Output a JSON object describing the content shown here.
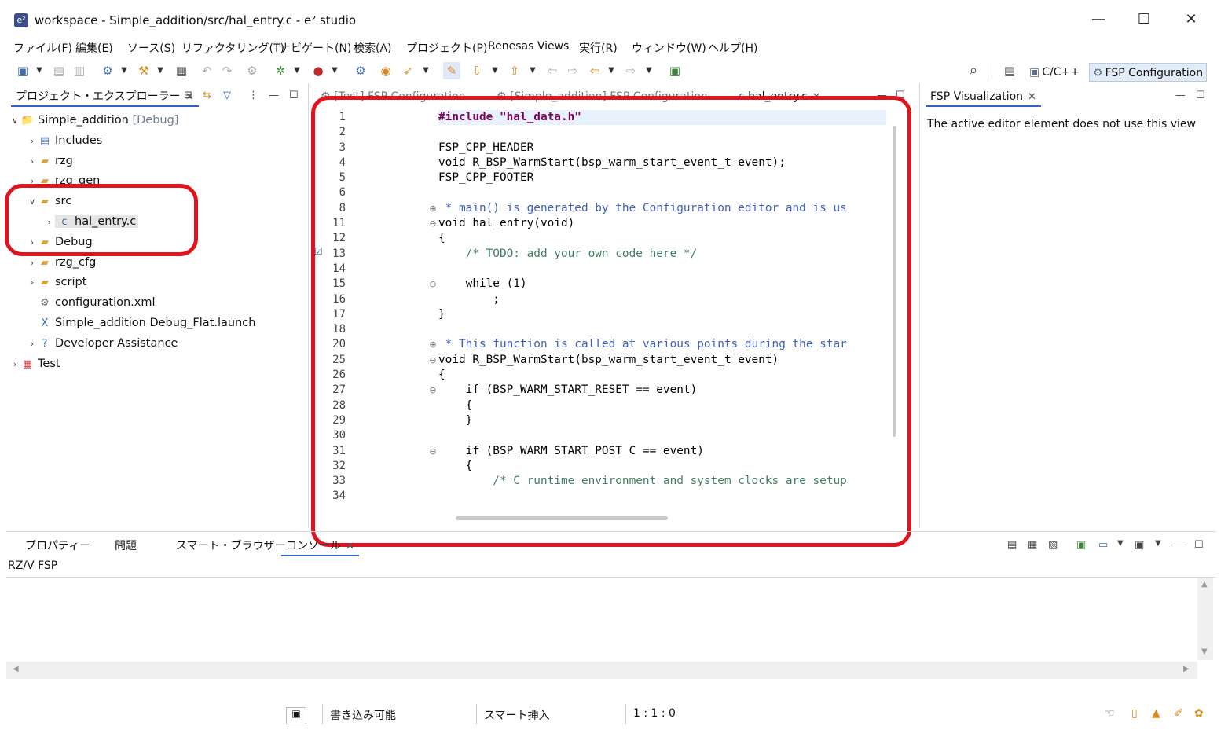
{
  "window": {
    "title": "workspace - Simple_addition/src/hal_entry.c - e² studio",
    "minimize": "—",
    "maximize": "☐",
    "close": "✕"
  },
  "menu": [
    "ファイル(F)",
    "編集(E)",
    "ソース(S)",
    "リファクタリング(T)",
    "ナビゲート(N)",
    "検索(A)",
    "プロジェクト(P)",
    "Renesas Views",
    "実行(R)",
    "ウィンドウ(W)",
    "ヘルプ(H)"
  ],
  "perspectives": {
    "cpp": "C/C++",
    "fsp": "FSP Configuration"
  },
  "explorer": {
    "tab": "プロジェクト・エクスプローラー",
    "items": [
      {
        "label": "Simple_addition",
        "suffix": "[Debug]"
      },
      {
        "label": "Includes"
      },
      {
        "label": "rzg"
      },
      {
        "label": "rzg_gen"
      },
      {
        "label": "src"
      },
      {
        "label": "hal_entry.c"
      },
      {
        "label": "Debug"
      },
      {
        "label": "rzg_cfg"
      },
      {
        "label": "script"
      },
      {
        "label": "configuration.xml"
      },
      {
        "label": "Simple_addition Debug_Flat.launch"
      },
      {
        "label": "Developer Assistance"
      },
      {
        "label": "Test"
      }
    ]
  },
  "editor_tabs": [
    "[Test] FSP Configuration",
    "[Simple_addition] FSP Configuration",
    "hal_entry.c"
  ],
  "editor": {
    "line_numbers": [
      "1",
      "2",
      "3",
      "4",
      "5",
      "6",
      "8",
      "11",
      "12",
      "13",
      "14",
      "15",
      "16",
      "17",
      "18",
      "20",
      "25",
      "26",
      "27",
      "28",
      "29",
      "30",
      "31",
      "32",
      "33",
      "34"
    ],
    "lines": [
      "#include \"hal_data.h\"",
      "",
      "FSP_CPP_HEADER",
      "void R_BSP_WarmStart(bsp_warm_start_event_t event);",
      "FSP_CPP_FOOTER",
      "",
      " * main() is generated by the Configuration editor and is us",
      "void hal_entry(void)",
      "{",
      "    /* TODO: add your own code here */",
      "",
      "    while (1)",
      "        ;",
      "}",
      "",
      " * This function is called at various points during the star",
      "void R_BSP_WarmStart(bsp_warm_start_event_t event)",
      "{",
      "    if (BSP_WARM_START_RESET == event)",
      "    {",
      "    }",
      "",
      "    if (BSP_WARM_START_POST_C == event)",
      "    {",
      "        /* C runtime environment and system clocks are setup",
      ""
    ]
  },
  "fsp_view": {
    "tab": "FSP Visualization",
    "message": "The active editor element does not use this view"
  },
  "bottom": {
    "tabs": [
      "プロパティー",
      "問題",
      "スマート・ブラウザー",
      "コンソール"
    ],
    "console_name": "RZ/V FSP"
  },
  "status": {
    "writable": "書き込み可能",
    "insert": "スマート挿入",
    "position": "1 : 1 : 0"
  }
}
